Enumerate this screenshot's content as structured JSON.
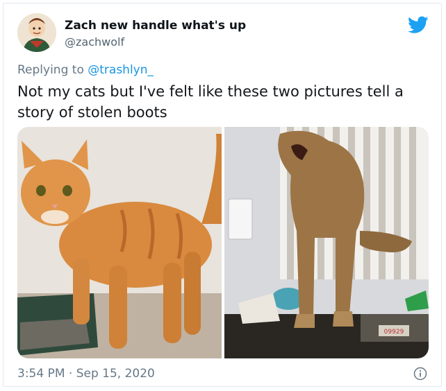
{
  "user": {
    "display_name": "Zach new handle what's up",
    "handle": "@zachwolf"
  },
  "reply": {
    "prefix": "Replying to ",
    "mention": "@trashlyn_"
  },
  "tweet": {
    "text": "Not my cats but I've felt like these two pictures tell a story of stolen boots",
    "timestamp": "3:54 PM · Sep 15, 2020"
  },
  "photo_right": {
    "box_label": "09929"
  },
  "colors": {
    "brand": "#1da1f2",
    "link": "#1b95e0",
    "secondary_text": "#657786"
  },
  "icons": {
    "bird": "twitter-bird-icon",
    "info": "info-icon"
  }
}
